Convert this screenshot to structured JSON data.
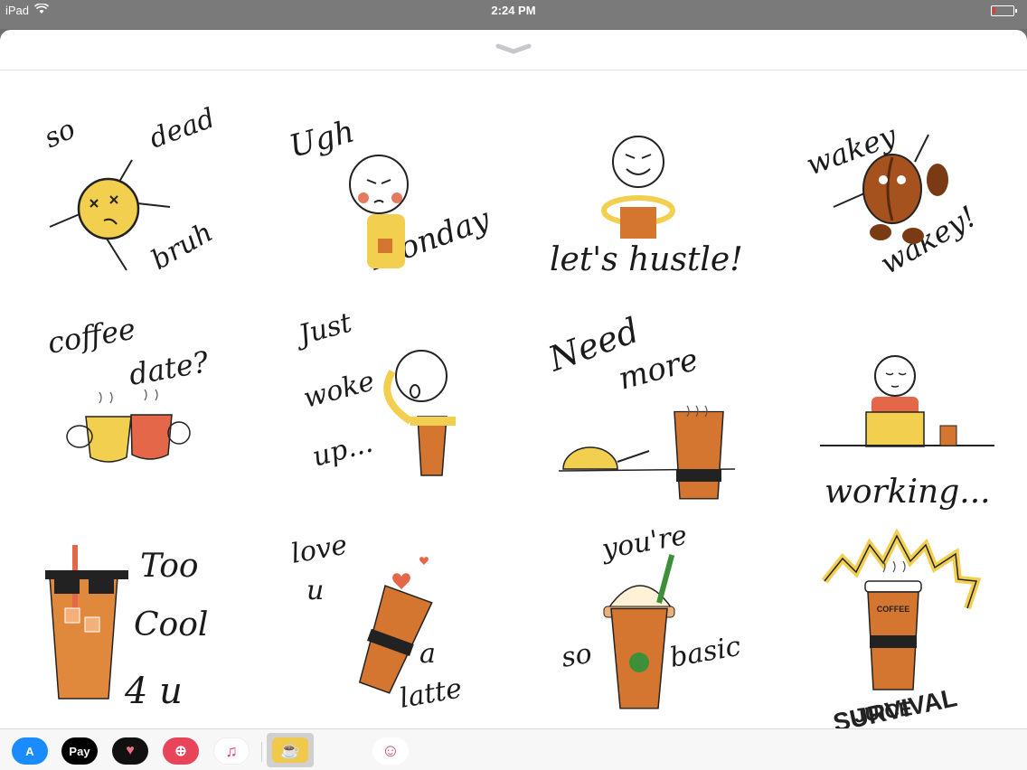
{
  "status_bar": {
    "device": "iPad",
    "time": "2:24 PM",
    "wifi_icon": "wifi-icon",
    "battery_icon": "battery-low-icon"
  },
  "stickers": [
    {
      "name": "so-dead-bruh",
      "words": [
        "so",
        "dead",
        "bruh"
      ]
    },
    {
      "name": "ugh-monday",
      "words": [
        "Ugh",
        "Monday"
      ]
    },
    {
      "name": "lets-hustle",
      "words": [
        "let's hustle!"
      ]
    },
    {
      "name": "wakey-wakey",
      "words": [
        "wakey",
        "wakey!"
      ]
    },
    {
      "name": "coffee-date",
      "words": [
        "coffee",
        "date?"
      ]
    },
    {
      "name": "just-woke-up",
      "words": [
        "Just",
        "woke",
        "up..."
      ]
    },
    {
      "name": "need-more",
      "words": [
        "Need",
        "more"
      ]
    },
    {
      "name": "working",
      "words": [
        "working..."
      ]
    },
    {
      "name": "too-cool-4-u",
      "words": [
        "Too",
        "Cool",
        "4 u"
      ]
    },
    {
      "name": "love-u-a-latte",
      "words": [
        "love",
        "u",
        "a",
        "latte"
      ]
    },
    {
      "name": "youre-so-basic",
      "words": [
        "you're",
        "so",
        "basic"
      ]
    },
    {
      "name": "survival-juice",
      "words": [
        "SURVIVAL",
        "JUICE",
        "COFFEE"
      ]
    }
  ],
  "tray": {
    "apps": [
      {
        "name": "app-store-icon",
        "label": "A",
        "color": "#1a8cff"
      },
      {
        "name": "apple-pay-icon",
        "label": " Pay",
        "color": "#000000"
      },
      {
        "name": "digital-touch-icon",
        "label": "♥",
        "color": "#111111"
      },
      {
        "name": "image-search-icon",
        "label": "⊕",
        "color": "#e8455b"
      },
      {
        "name": "music-icon",
        "label": "♫",
        "color": "#ffffff"
      },
      {
        "name": "coffee-stickers-icon",
        "label": "☕",
        "color": "#f1c94a"
      },
      {
        "name": "avatar-sticker-icon",
        "label": "☺",
        "color": "#ffffff"
      }
    ]
  },
  "colors": {
    "coffee_orange": "#d4762f",
    "mug_yellow": "#f2cf4e",
    "bean_brown": "#7a3b14"
  }
}
